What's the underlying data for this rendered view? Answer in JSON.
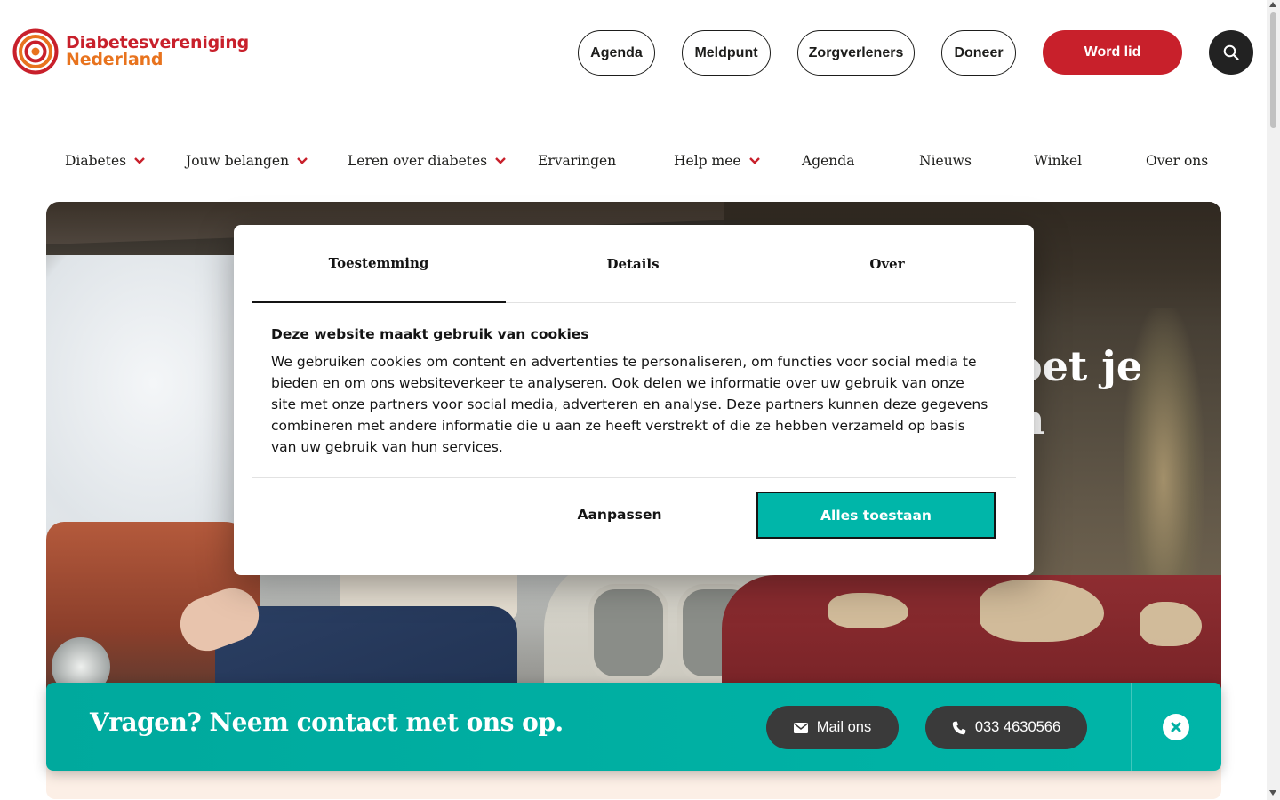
{
  "brand": {
    "line1": "Diabetesvereniging",
    "line2": "Nederland",
    "red": "#c8202b",
    "orange": "#e8731e"
  },
  "topnav": {
    "agenda": "Agenda",
    "meldpunt": "Meldpunt",
    "zorgverleners": "Zorgverleners",
    "doneer": "Doneer",
    "word_lid": "Word lid",
    "search_icon": "search-icon"
  },
  "mainnav": [
    {
      "label": "Diabetes",
      "has_dropdown": true
    },
    {
      "label": "Jouw belangen",
      "has_dropdown": true
    },
    {
      "label": "Leren over diabetes",
      "has_dropdown": true
    },
    {
      "label": "Ervaringen",
      "has_dropdown": false
    },
    {
      "label": "Help mee",
      "has_dropdown": true
    },
    {
      "label": "Agenda",
      "has_dropdown": false
    },
    {
      "label": "Nieuws",
      "has_dropdown": false
    },
    {
      "label": "Winkel",
      "has_dropdown": false
    },
    {
      "label": "Over ons",
      "has_dropdown": false
    }
  ],
  "hero": {
    "title_line1": "oet je",
    "title_line2": "n"
  },
  "cookie": {
    "tabs": [
      "Toestemming",
      "Details",
      "Over"
    ],
    "active_tab": "Toestemming",
    "heading": "Deze website maakt gebruik van cookies",
    "body": "We gebruiken cookies om content en advertenties te personaliseren, om functies voor social media te bieden en om ons websiteverkeer te analyseren. Ook delen we informatie over uw gebruik van onze site met onze partners voor social media, adverteren en analyse. Deze partners kunnen deze gegevens combineren met andere informatie die u aan ze heeft verstrekt of die ze hebben verzameld op basis van uw gebruik van hun services.",
    "adjust_label": "Aanpassen",
    "allow_label": "Alles toestaan",
    "accent": "#00b6a9"
  },
  "contact": {
    "question": "Vragen? Neem contact met ons op.",
    "mail_label": "Mail ons",
    "phone_label": "033 4630566",
    "accent": "#00b5a8"
  }
}
